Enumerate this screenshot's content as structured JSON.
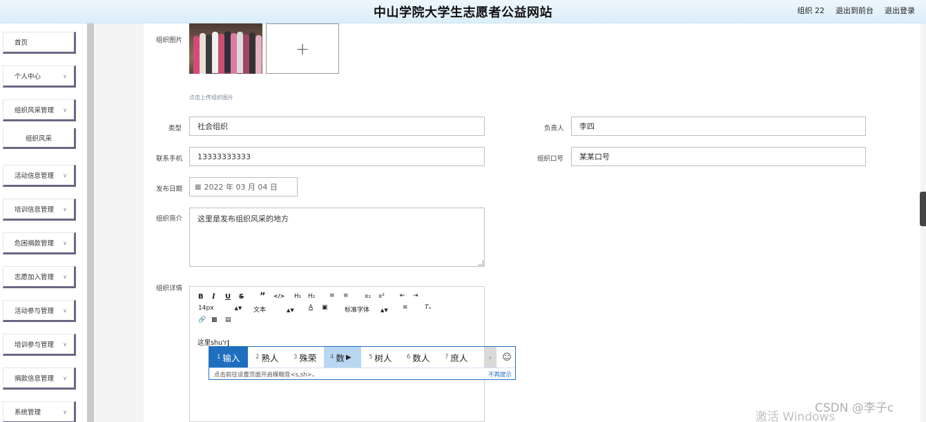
{
  "header": {
    "title": "中山学院大学生志愿者公益网站",
    "user": "组织 22",
    "back_front": "退出到前台",
    "logout": "退出登录"
  },
  "sidebar": {
    "items": [
      {
        "label": "首页",
        "chevron": false
      },
      {
        "label": "个人中心",
        "chevron": true
      },
      {
        "label": "组织风采管理",
        "chevron": true
      },
      {
        "label": "组织风采",
        "chevron": false,
        "sub": true
      },
      {
        "label": "活动信息管理",
        "chevron": true
      },
      {
        "label": "培训信息管理",
        "chevron": true
      },
      {
        "label": "危困捐款管理",
        "chevron": true
      },
      {
        "label": "志愿加入管理",
        "chevron": true
      },
      {
        "label": "活动参与管理",
        "chevron": true
      },
      {
        "label": "培训参与管理",
        "chevron": true
      },
      {
        "label": "捐款信息管理",
        "chevron": true
      },
      {
        "label": "系统管理",
        "chevron": true
      }
    ]
  },
  "form": {
    "image_label": "组织图片",
    "upload_hint": "点击上传组织图片",
    "upload_plus": "+",
    "type_label": "类型",
    "type_value": "社会组织",
    "leader_label": "负责人",
    "leader_value": "李四",
    "phone_label": "联系手机",
    "phone_value": "13333333333",
    "slogan_label": "组织口号",
    "slogan_value": "某某口号",
    "date_label": "发布日期",
    "date_value": "2022 年 03 月 04 日",
    "intro_label": "组织简介",
    "intro_value": "这里是发布组织风采的地方",
    "detail_label": "组织详情"
  },
  "editor": {
    "font_size": "14px",
    "paragraph": "文本",
    "font_family": "标准字体",
    "content": "这里shu'r"
  },
  "ime": {
    "candidates": [
      "输入",
      "熟人",
      "殊荣",
      "数",
      "树人",
      "数人",
      "庶人"
    ],
    "tip": "点击前往设置页面开启模糊音<s,sh>。",
    "dismiss": "不再提示"
  },
  "watermarks": {
    "activate": "激活 Windows",
    "csdn": "CSDN @李子c"
  },
  "colors": {
    "accent": "#1f6fbf",
    "menu_border": "#6b6683"
  }
}
